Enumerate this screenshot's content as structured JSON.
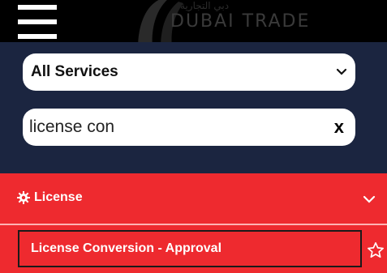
{
  "header": {
    "logo_arabic": "دبي التجارية",
    "logo_text": "DUBAI TRADE",
    "menu_icon": "hamburger-icon"
  },
  "filters": {
    "service_select": {
      "selected": "All Services",
      "icon": "chevron-down-icon"
    },
    "search": {
      "value": "license con",
      "clear_label": "x"
    }
  },
  "category": {
    "label": "License",
    "icon": "gear-icon",
    "expand_icon": "chevron-down-icon",
    "items": [
      {
        "label": "License Conversion - Approval",
        "icon": "star-icon"
      }
    ]
  },
  "colors": {
    "topbar": "#000000",
    "panel": "#1b2540",
    "accent_red": "#ee2a2f"
  }
}
